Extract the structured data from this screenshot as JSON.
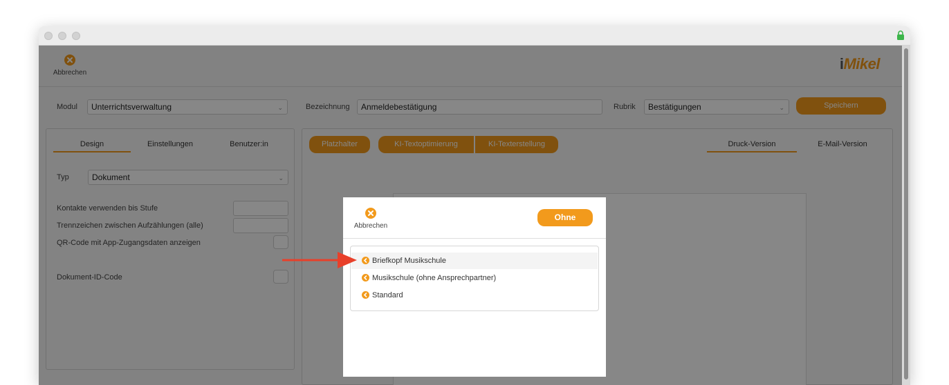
{
  "toolbar": {
    "cancel_label": "Abbrechen",
    "logo": "iMikel"
  },
  "form": {
    "modul_label": "Modul",
    "modul_value": "Unterrichtsverwaltung",
    "bezeichnung_label": "Bezeichnung",
    "bezeichnung_value": "Anmeldebestätigung",
    "rubrik_label": "Rubrik",
    "rubrik_value": "Bestätigungen",
    "save_label": "Speichern"
  },
  "left_panel": {
    "tabs": [
      "Design",
      "Einstellungen",
      "Benutzer:in"
    ],
    "typ_label": "Typ",
    "typ_value": "Dokument",
    "fields": [
      "Kontakte verwenden bis Stufe",
      "Trennzeichen zwischen Aufzählungen (alle)",
      "QR-Code mit App-Zugangsdaten anzeigen",
      "Dokument-ID-Code"
    ]
  },
  "right_panel": {
    "buttons": [
      "Platzhalter",
      "KI-Textoptimierung",
      "KI-Texterstellung"
    ],
    "tabs": [
      "Druck-Version",
      "E-Mail-Version"
    ]
  },
  "modal": {
    "cancel_label": "Abbrechen",
    "none_label": "Ohne",
    "items": [
      "Briefkopf Musikschule",
      "Musikschule (ohne Ansprechpartner)",
      "Standard"
    ]
  },
  "colors": {
    "accent": "#f29a1c",
    "arrow": "#e8402a"
  },
  "icons": {
    "cancel": "x-circle-icon",
    "item_bullet": "arrow-left-circle-icon",
    "lock": "lock-icon"
  }
}
